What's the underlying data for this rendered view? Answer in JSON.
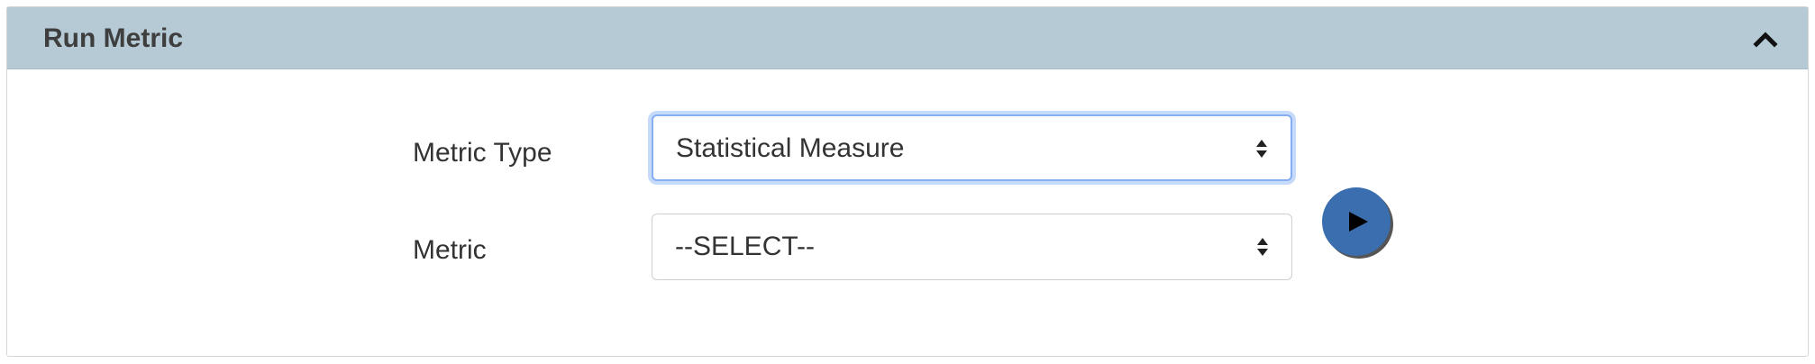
{
  "panel": {
    "title": "Run Metric",
    "collapse_icon": "chevron-up-icon"
  },
  "form": {
    "metric_type": {
      "label": "Metric Type",
      "selected": "Statistical Measure"
    },
    "metric": {
      "label": "Metric",
      "selected": "--SELECT--"
    },
    "run_icon": "play-icon"
  },
  "colors": {
    "header_bg": "#b5cad5",
    "run_button": "#3b6eae",
    "focus_ring": "#86aef2"
  }
}
